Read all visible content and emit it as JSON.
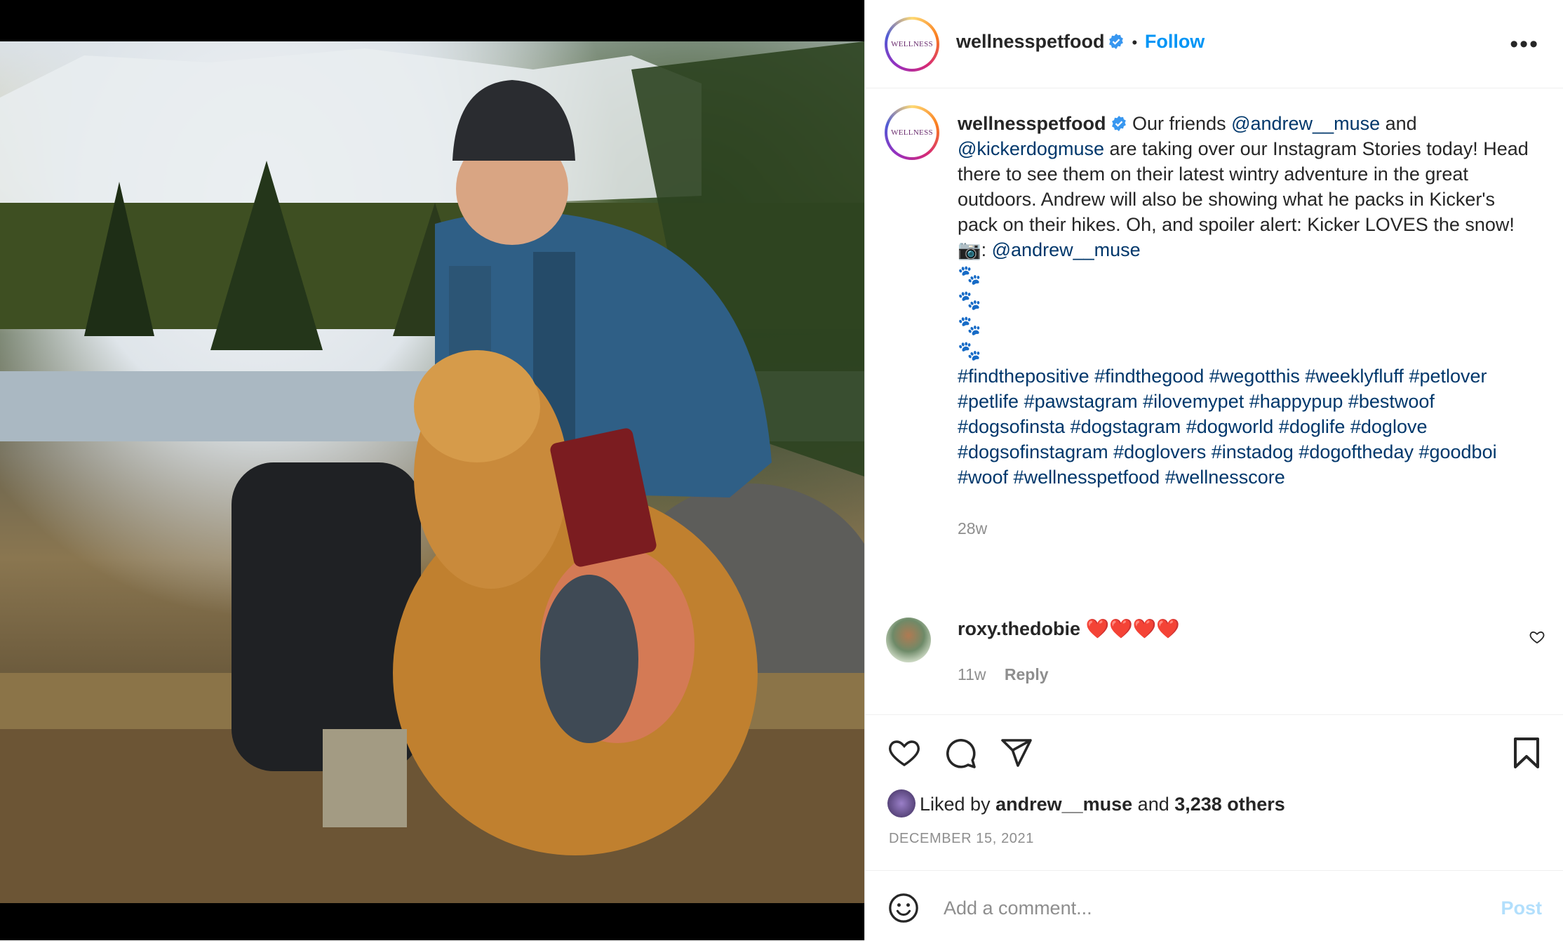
{
  "post": {
    "author": "wellnesspetfood",
    "follow_label": "Follow",
    "avatar_logo": "WELLNESS"
  },
  "caption": {
    "author": "wellnesspetfood",
    "text_1": " Our friends ",
    "mention_1": "@andrew__muse",
    "text_2": " and ",
    "mention_2": "@kickerdogmuse",
    "text_3": " are taking over our Instagram Stories today! Head there to see them on their latest wintry adventure in the great outdoors. Andrew will also be showing what he packs in Kicker's pack on their hikes. Oh, and spoiler alert: Kicker LOVES the snow!",
    "camera_prefix": "📷: ",
    "camera_mention": "@andrew__muse",
    "paws": [
      "🐾",
      "🐾",
      "🐾",
      "🐾"
    ],
    "hashtags": "#findthepositive #findthegood #wegotthis #weeklyfluff #petlover #petlife #pawstagram #ilovemypet #happypup #bestwoof #dogsofinsta #dogstagram #dogworld #doglife #doglove #dogsofinstagram #doglovers #instadog #dogoftheday #goodboi #woof #wellnesspetfood #wellnesscore",
    "time": "28w"
  },
  "comment": {
    "user": "roxy.thedobie",
    "text": "❤️❤️❤️❤️",
    "time": "11w",
    "reply_label": "Reply"
  },
  "actions": {
    "liked_by_prefix": "Liked by ",
    "liked_by_user": "andrew__muse",
    "liked_by_and": " and ",
    "liked_by_others": "3,238 others",
    "date": "DECEMBER 15, 2021"
  },
  "add_comment": {
    "placeholder": "Add a comment...",
    "post_label": "Post"
  },
  "colors": {
    "accent": "#0095f6",
    "link": "#00376b",
    "muted": "#8e8e8e"
  },
  "icons": [
    "verified-icon",
    "more-icon",
    "heart-icon",
    "comment-icon",
    "share-icon",
    "bookmark-icon",
    "emoji-icon",
    "like-comment-icon"
  ]
}
